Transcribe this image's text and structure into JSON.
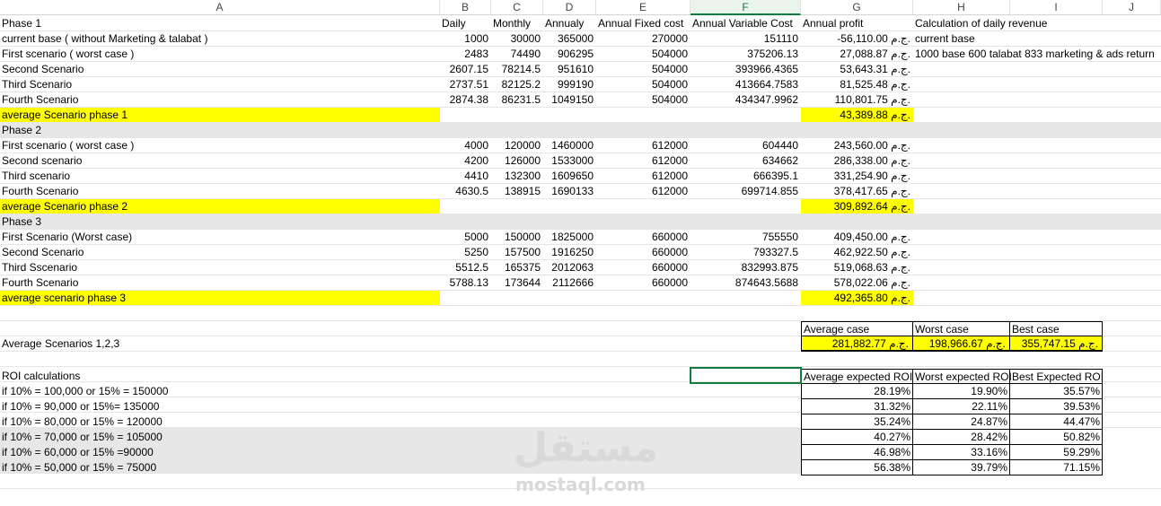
{
  "columns": [
    "A",
    "B",
    "C",
    "D",
    "E",
    "F",
    "G",
    "H",
    "I",
    "J"
  ],
  "rows": [
    {
      "a": "Phase 1",
      "b": "Daily",
      "c": "Monthly",
      "d": "Annualy",
      "e": "Annual Fixed cost",
      "f": "Annual Variable Cost",
      "g": "Annual profit",
      "h": "Calculation of daily revenue",
      "hdr": true
    },
    {
      "a": "current base ( without Marketing & talabat )",
      "b": "1000",
      "c": "30000",
      "d": "365000",
      "e": "270000",
      "f": "151110",
      "g": "-56,110.00 ج.م.",
      "h": "current base"
    },
    {
      "a": "First scenario ( worst case )",
      "b": "2483",
      "c": "74490",
      "d": "906295",
      "e": "504000",
      "f": "375206.13",
      "g": "27,088.87 ج.م.",
      "h": "1000 base 600 talabat 833 marketing & ads return"
    },
    {
      "a": "Second Scenario",
      "b": "2607.15",
      "c": "78214.5",
      "d": "951610",
      "e": "504000",
      "f": "393966.4365",
      "g": "53,643.31 ج.م."
    },
    {
      "a": "Third Scenario",
      "b": "2737.51",
      "c": "82125.2",
      "d": "999190",
      "e": "504000",
      "f": "413664.7583",
      "g": "81,525.48 ج.م."
    },
    {
      "a": "Fourth Scenario",
      "b": "2874.38",
      "c": "86231.5",
      "d": "1049150",
      "e": "504000",
      "f": "434347.9962",
      "g": "110,801.75 ج.م."
    },
    {
      "a": "average Scenario phase 1",
      "g": "43,389.88 ج.م.",
      "yellow": true
    },
    {
      "a": "Phase 2",
      "gray": true
    },
    {
      "a": "First scenario ( worst case )",
      "b": "4000",
      "c": "120000",
      "d": "1460000",
      "e": "612000",
      "f": "604440",
      "g": "243,560.00 ج.م."
    },
    {
      "a": "Second scenario",
      "b": "4200",
      "c": "126000",
      "d": "1533000",
      "e": "612000",
      "f": "634662",
      "g": "286,338.00 ج.م."
    },
    {
      "a": "Third scenario",
      "b": "4410",
      "c": "132300",
      "d": "1609650",
      "e": "612000",
      "f": "666395.1",
      "g": "331,254.90 ج.م."
    },
    {
      "a": "Fourth Scenario",
      "b": "4630.5",
      "c": "138915",
      "d": "1690133",
      "e": "612000",
      "f": "699714.855",
      "g": "378,417.65 ج.م."
    },
    {
      "a": "average Scenario phase 2",
      "g": "309,892.64 ج.م.",
      "yellow": true
    },
    {
      "a": "Phase 3",
      "gray": true
    },
    {
      "a": "First Scenario (Worst case)",
      "b": "5000",
      "c": "150000",
      "d": "1825000",
      "e": "660000",
      "f": "755550",
      "g": "409,450.00 ج.م."
    },
    {
      "a": "Second Scenario",
      "b": "5250",
      "c": "157500",
      "d": "1916250",
      "e": "660000",
      "f": "793327.5",
      "g": "462,922.50 ج.م."
    },
    {
      "a": "Third Sscenario",
      "b": "5512.5",
      "c": "165375",
      "d": "2012063",
      "e": "660000",
      "f": "832993.875",
      "g": "519,068.63 ج.م."
    },
    {
      "a": "Fourth Scenario",
      "b": "5788.13",
      "c": "173644",
      "d": "2112666",
      "e": "660000",
      "f": "874643.5688",
      "g": "578,022.06 ج.م."
    },
    {
      "a": "average scenario phase 3",
      "g": "492,365.80 ج.م.",
      "yellow": true
    }
  ],
  "average_block": {
    "label": "Average Scenarios 1,2,3",
    "headers": [
      "Average case",
      "Worst case",
      "Best case"
    ],
    "values": [
      "281,882.77 ج.م.",
      "198,966.67 ج.م.",
      "355,747.15 ج.م."
    ]
  },
  "roi": {
    "title": "ROI calculations",
    "labels": [
      "if 10% = 100,000 or 15% = 150000",
      "if 10% = 90,000 or 15%= 135000",
      "if 10% = 80,000 or 15% = 120000",
      "if 10% = 70,000 or 15% = 105000",
      "if 10% = 60,000 or 15% =90000",
      "if 10% = 50,000 or 15% = 75000"
    ],
    "headers": [
      "Average expected ROI",
      "Worst expected ROI",
      "Best Expected ROI"
    ],
    "values": [
      [
        "28.19%",
        "19.90%",
        "35.57%"
      ],
      [
        "31.32%",
        "22.11%",
        "39.53%"
      ],
      [
        "35.24%",
        "24.87%",
        "44.47%"
      ],
      [
        "40.27%",
        "28.42%",
        "50.82%"
      ],
      [
        "46.98%",
        "33.16%",
        "59.29%"
      ],
      [
        "56.38%",
        "39.79%",
        "71.15%"
      ]
    ]
  },
  "watermark": {
    "arabic": "مستقل",
    "latin": "mostaql.com"
  },
  "selected_column": "F"
}
